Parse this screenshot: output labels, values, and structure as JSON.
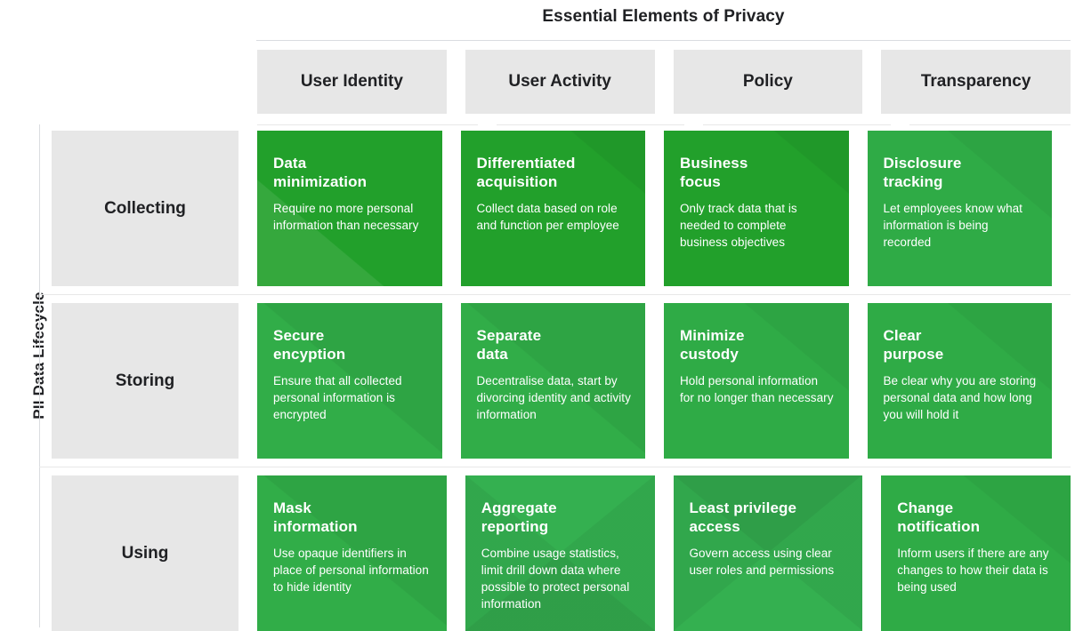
{
  "header": {
    "title": "Essential Elements of Privacy"
  },
  "axis": {
    "y_label": "PII Data Lifecycle"
  },
  "colors": {
    "green_dark": "#22a02b",
    "green_mid": "#31ad48",
    "green_light": "#2fab46",
    "green_pale": "#34b050",
    "gray_cell": "#e7e7e7",
    "rule": "#dadce0",
    "text": "#202124",
    "cell_text": "#ffffff"
  },
  "columns": [
    {
      "label": "User Identity"
    },
    {
      "label": "User Activity"
    },
    {
      "label": "Policy"
    },
    {
      "label": "Transparency"
    }
  ],
  "rows": [
    {
      "label": "Collecting",
      "cells": [
        {
          "title": "Data\nminimization",
          "desc": "Require no more personal information than necessary"
        },
        {
          "title": "Differentiated\nacquisition",
          "desc": "Collect data based on role and function per employee"
        },
        {
          "title": "Business\nfocus",
          "desc": "Only track data that is needed to complete business objectives"
        },
        {
          "title": "Disclosure\ntracking",
          "desc": "Let employees know what information is being recorded"
        }
      ]
    },
    {
      "label": "Storing",
      "cells": [
        {
          "title": "Secure\nencyption",
          "desc": "Ensure that all collected personal  information is encrypted"
        },
        {
          "title": "Separate\ndata",
          "desc": "Decentralise data, start by divorcing identity and activity information"
        },
        {
          "title": "Minimize\ncustody",
          "desc": "Hold personal information for no longer than necessary"
        },
        {
          "title": "Clear\npurpose",
          "desc": "Be clear why you are storing personal data and how long you will hold it"
        }
      ]
    },
    {
      "label": "Using",
      "cells": [
        {
          "title": "Mask\ninformation",
          "desc": "Use opaque identifiers in place of personal information to hide identity"
        },
        {
          "title": "Aggregate\nreporting",
          "desc": "Combine usage statistics, limit drill down data where possible to protect personal information"
        },
        {
          "title": "Least privilege\naccess",
          "desc": "Govern access using clear user roles and permissions"
        },
        {
          "title": "Change\nnotification",
          "desc": "Inform users if there are any changes to how their data is being used"
        }
      ]
    }
  ]
}
